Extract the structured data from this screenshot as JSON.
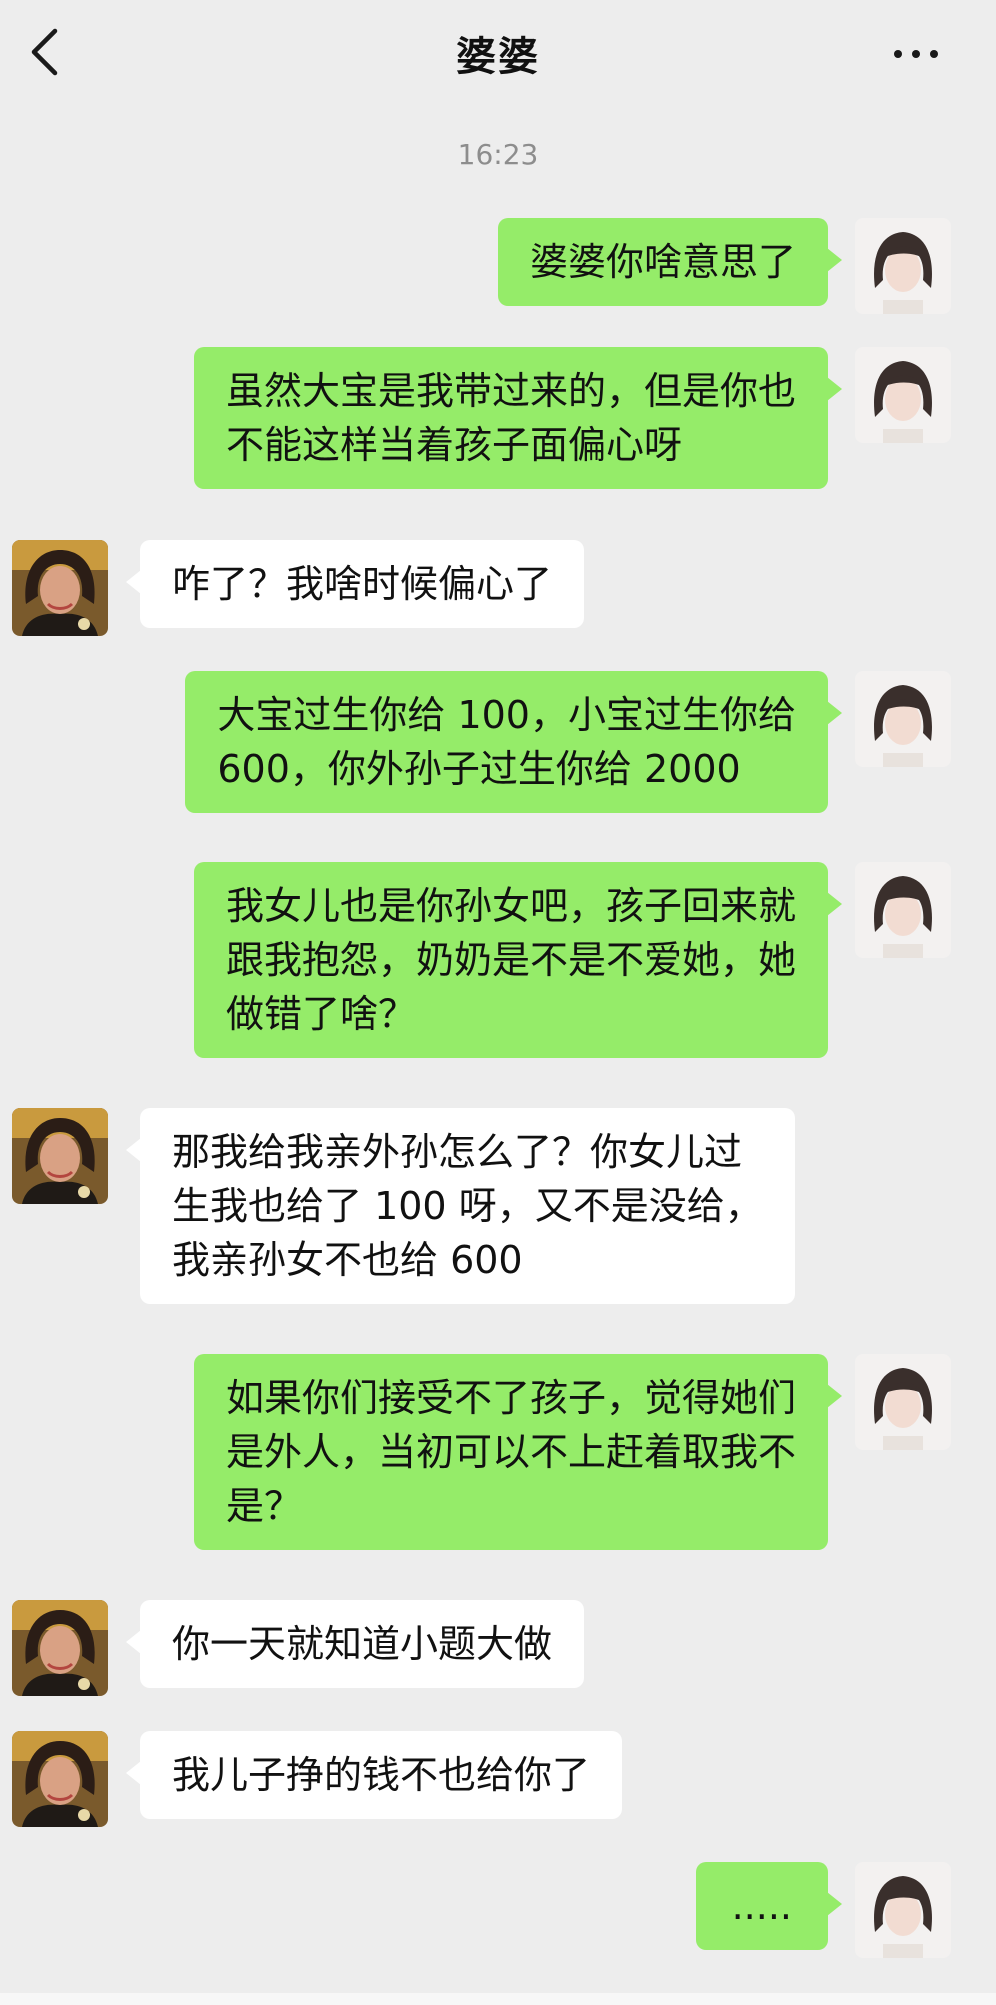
{
  "header": {
    "title": "婆婆",
    "back_icon": "chevron-left-icon",
    "more_icon": "more-horizontal-icon"
  },
  "timestamp": "16:23",
  "colors": {
    "background": "#ededed",
    "outgoing_bubble": "#95ec69",
    "incoming_bubble": "#ffffff",
    "timestamp_text": "#8d8d8d"
  },
  "messages": [
    {
      "sender": "me",
      "text": "婆婆你啥意思了"
    },
    {
      "sender": "me",
      "text": "虽然大宝是我带过来的，但是你也\n不能这样当着孩子面偏心呀"
    },
    {
      "sender": "mother-in-law",
      "text": "咋了？我啥时候偏心了"
    },
    {
      "sender": "me",
      "text": "大宝过生你给 100，小宝过生你给\n600，你外孙子过生你给 2000"
    },
    {
      "sender": "me",
      "text": "我女儿也是你孙女吧，孩子回来就\n跟我抱怨，奶奶是不是不爱她，她\n做错了啥？"
    },
    {
      "sender": "mother-in-law",
      "text": "那我给我亲外孙怎么了？你女儿过\n生我也给了 100 呀，又不是没给，\n我亲孙女不也给 600"
    },
    {
      "sender": "me",
      "text": "如果你们接受不了孩子，觉得她们\n是外人，当初可以不上赶着取我不\n是？"
    },
    {
      "sender": "mother-in-law",
      "text": "你一天就知道小题大做"
    },
    {
      "sender": "mother-in-law",
      "text": "我儿子挣的钱不也给你了"
    },
    {
      "sender": "me",
      "text": "....."
    }
  ]
}
